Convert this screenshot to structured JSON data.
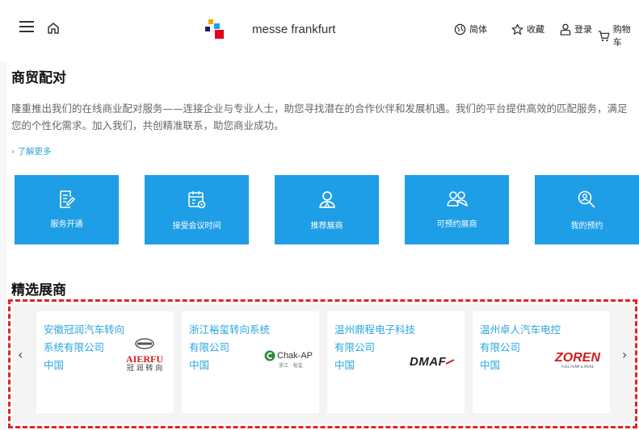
{
  "header": {
    "brand": "messe frankfurt",
    "language": "简体",
    "favorites": "收藏",
    "login": "登录",
    "cart": "购物车"
  },
  "matchmaking": {
    "title": "商贸配对",
    "description": "隆重推出我们的在线商业配对服务——连接企业与专业人士，助您寻找潜在的合作伙伴和发展机遇。我们的平台提供高效的匹配服务，满足您的个性化需求。加入我们，共创精准联系，助您商业成功。",
    "more_link": "› 了解更多",
    "tiles": [
      {
        "label": "服务开通",
        "icon": "document-edit-icon"
      },
      {
        "label": "接受会议时间",
        "icon": "calendar-settings-icon"
      },
      {
        "label": "推荐展商",
        "icon": "recommend-user-icon"
      },
      {
        "label": "可预约展商",
        "icon": "group-users-icon"
      },
      {
        "label": "我的预约",
        "icon": "search-user-icon"
      }
    ]
  },
  "featured": {
    "title": "精选展商",
    "exhibitors": [
      {
        "name": "安徽冠润汽车转向系统有限公司",
        "country": "中国",
        "logo_text": "AIERFU",
        "logo_sub": "冠 润 转 向"
      },
      {
        "name": "浙江裕玺转向系统有限公司",
        "country": "中国",
        "logo_text": "Chak-AP",
        "logo_sub": "浙江 · 裕玺"
      },
      {
        "name": "温州鼎程电子科技有限公司",
        "country": "中国",
        "logo_text": "DMAF"
      },
      {
        "name": "温州卓人汽车电控有限公司",
        "country": "中国",
        "logo_text": "ZOREN",
        "logo_sub": "FUEL PUMP & MORE"
      }
    ],
    "prev": "‹",
    "next": "›"
  },
  "colors": {
    "accent": "#1e9ee6",
    "link": "#2aa6e0",
    "highlight": "#e02424"
  }
}
